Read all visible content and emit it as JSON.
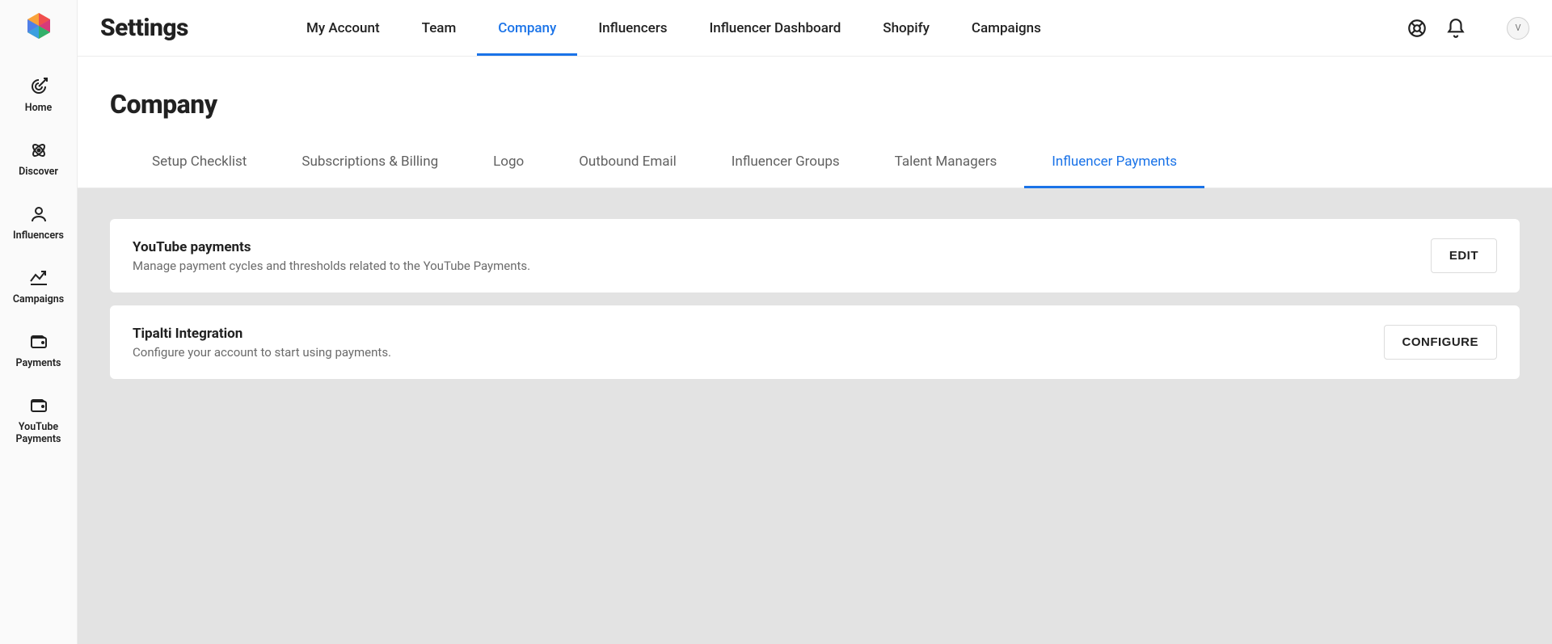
{
  "sidebar": {
    "items": [
      {
        "label": "Home"
      },
      {
        "label": "Discover"
      },
      {
        "label": "Influencers"
      },
      {
        "label": "Campaigns"
      },
      {
        "label": "Payments"
      },
      {
        "label": "YouTube\nPayments"
      }
    ]
  },
  "topbar": {
    "title": "Settings",
    "nav": [
      {
        "label": "My Account"
      },
      {
        "label": "Team"
      },
      {
        "label": "Company"
      },
      {
        "label": "Influencers"
      },
      {
        "label": "Influencer Dashboard"
      },
      {
        "label": "Shopify"
      },
      {
        "label": "Campaigns"
      }
    ],
    "avatar_initial": "V"
  },
  "subheader": {
    "title": "Company"
  },
  "section_tabs": [
    {
      "label": "Setup Checklist"
    },
    {
      "label": "Subscriptions & Billing"
    },
    {
      "label": "Logo"
    },
    {
      "label": "Outbound Email"
    },
    {
      "label": "Influencer Groups"
    },
    {
      "label": "Talent Managers"
    },
    {
      "label": "Influencer Payments"
    }
  ],
  "cards": [
    {
      "title": "YouTube payments",
      "desc": "Manage payment cycles and thresholds related to the YouTube Payments.",
      "button": "EDIT"
    },
    {
      "title": "Tipalti Integration",
      "desc": "Configure your account to start using payments.",
      "button": "CONFIGURE"
    }
  ]
}
